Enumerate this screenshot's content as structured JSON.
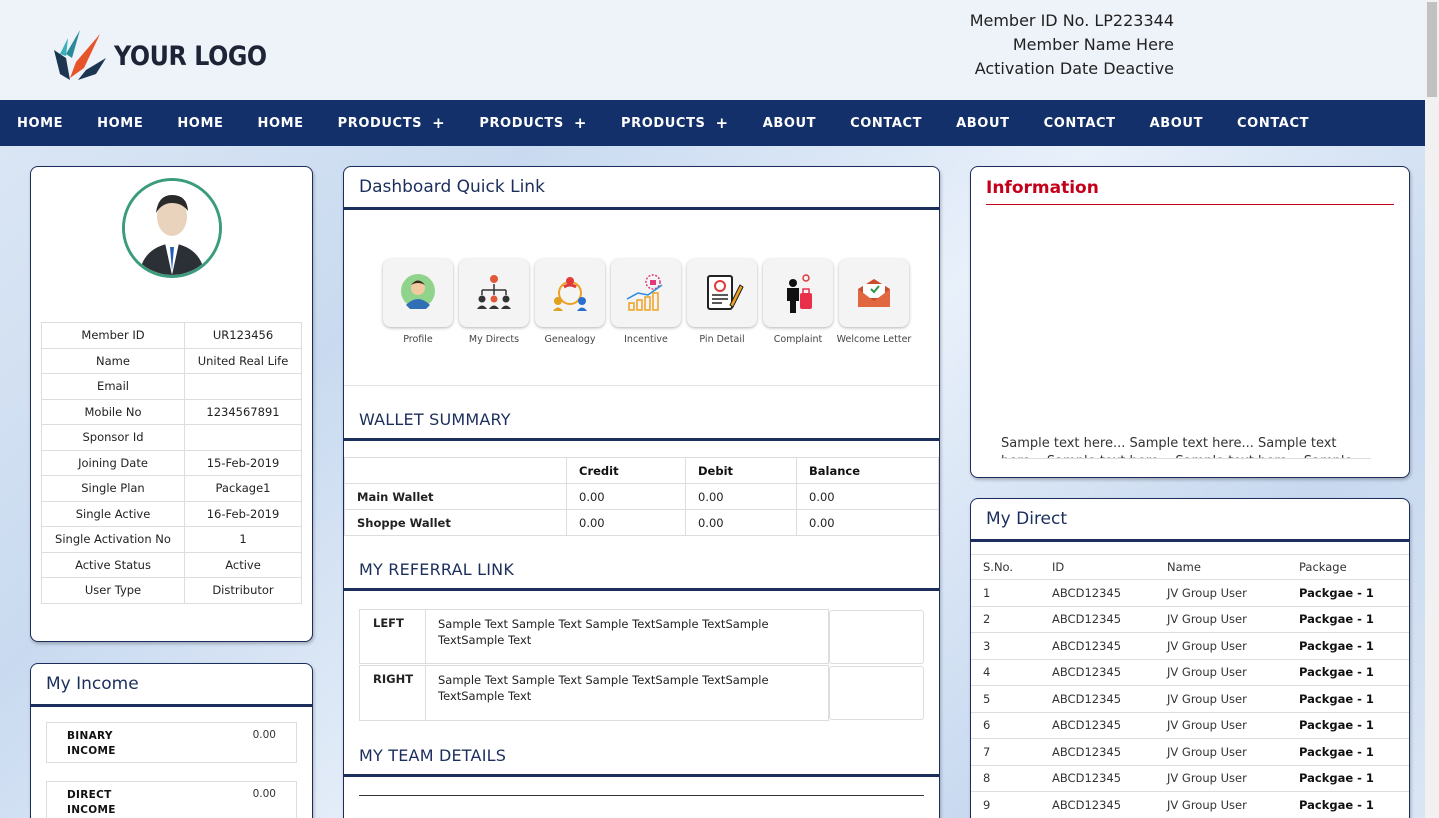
{
  "header": {
    "logo_text": "YOUR LOGO",
    "member_id_line": "Member ID No. LP223344",
    "member_name_line": "Member Name Here",
    "activation_line": "Activation Date Deactive"
  },
  "nav": {
    "items": [
      {
        "label": "HOME"
      },
      {
        "label": "HOME"
      },
      {
        "label": "HOME"
      },
      {
        "label": "HOME"
      },
      {
        "label": "PRODUCTS",
        "plus": "+"
      },
      {
        "label": "PRODUCTS",
        "plus": "+"
      },
      {
        "label": "PRODUCTS",
        "plus": "+"
      },
      {
        "label": "ABOUT"
      },
      {
        "label": "CONTACT"
      },
      {
        "label": "ABOUT"
      },
      {
        "label": "CONTACT"
      },
      {
        "label": "ABOUT"
      },
      {
        "label": "CONTACT"
      }
    ]
  },
  "profile": {
    "rows": [
      {
        "label": "Member ID",
        "value": "UR123456"
      },
      {
        "label": "Name",
        "value": "United Real Life"
      },
      {
        "label": "Email",
        "value": ""
      },
      {
        "label": "Mobile No",
        "value": "1234567891"
      },
      {
        "label": "Sponsor Id",
        "value": ""
      },
      {
        "label": "Joining Date",
        "value": "15-Feb-2019"
      },
      {
        "label": "Single Plan",
        "value": "Package1"
      },
      {
        "label": "Single Active",
        "value": "16-Feb-2019"
      },
      {
        "label": "Single Activation No",
        "value": "1"
      },
      {
        "label": "Active Status",
        "value": "Active"
      },
      {
        "label": "User Type",
        "value": "Distributor"
      }
    ]
  },
  "income": {
    "title": "My Income",
    "items": [
      {
        "label_1": "BINARY",
        "label_2": "INCOME",
        "value": "0.00"
      },
      {
        "label_1": "DIRECT",
        "label_2": "INCOME",
        "value": "0.00"
      }
    ]
  },
  "dashboard": {
    "title": "Dashboard Quick Link",
    "quick_links": [
      {
        "label": "Profile",
        "icon": "profile-icon"
      },
      {
        "label": "My Directs",
        "icon": "org-chart-icon"
      },
      {
        "label": "Genealogy",
        "icon": "genealogy-icon"
      },
      {
        "label": "Incentive",
        "icon": "incentive-icon"
      },
      {
        "label": "Pin Detail",
        "icon": "pin-detail-icon"
      },
      {
        "label": "Complaint",
        "icon": "complaint-icon"
      },
      {
        "label": "Welcome Letter",
        "icon": "letter-icon"
      }
    ],
    "wallet_title": "WALLET SUMMARY",
    "wallet_headers": [
      "",
      "Credit",
      "Debit",
      "Balance"
    ],
    "wallet_rows": [
      {
        "name": "Main Wallet",
        "credit": "0.00",
        "debit": "0.00",
        "balance": "0.00"
      },
      {
        "name": "Shoppe Wallet",
        "credit": "0.00",
        "debit": "0.00",
        "balance": "0.00"
      }
    ],
    "referral_title": "MY REFERRAL LINK",
    "referral": [
      {
        "side": "LEFT",
        "text": "Sample Text Sample Text Sample TextSample TextSample TextSample Text"
      },
      {
        "side": "RIGHT",
        "text": "Sample Text Sample Text Sample TextSample TextSample TextSample Text"
      }
    ],
    "team_title": "MY TEAM DETAILS"
  },
  "information": {
    "title": "Information",
    "text": "Sample text here... Sample text here... Sample text here... Sample text here... Sample text here... Sample"
  },
  "direct": {
    "title": "My Direct",
    "headers": [
      "S.No.",
      "ID",
      "Name",
      "Package"
    ],
    "rows": [
      {
        "sno": "1",
        "id": "ABCD12345",
        "name": "JV Group User",
        "pkg": "Packgae - 1"
      },
      {
        "sno": "2",
        "id": "ABCD12345",
        "name": "JV Group User",
        "pkg": "Packgae - 1"
      },
      {
        "sno": "3",
        "id": "ABCD12345",
        "name": "JV Group User",
        "pkg": "Packgae - 1"
      },
      {
        "sno": "4",
        "id": "ABCD12345",
        "name": "JV Group User",
        "pkg": "Packgae - 1"
      },
      {
        "sno": "5",
        "id": "ABCD12345",
        "name": "JV Group User",
        "pkg": "Packgae - 1"
      },
      {
        "sno": "6",
        "id": "ABCD12345",
        "name": "JV Group User",
        "pkg": "Packgae - 1"
      },
      {
        "sno": "7",
        "id": "ABCD12345",
        "name": "JV Group User",
        "pkg": "Packgae - 1"
      },
      {
        "sno": "8",
        "id": "ABCD12345",
        "name": "JV Group User",
        "pkg": "Packgae - 1"
      },
      {
        "sno": "9",
        "id": "ABCD12345",
        "name": "JV Group User",
        "pkg": "Packgae - 1"
      }
    ]
  }
}
